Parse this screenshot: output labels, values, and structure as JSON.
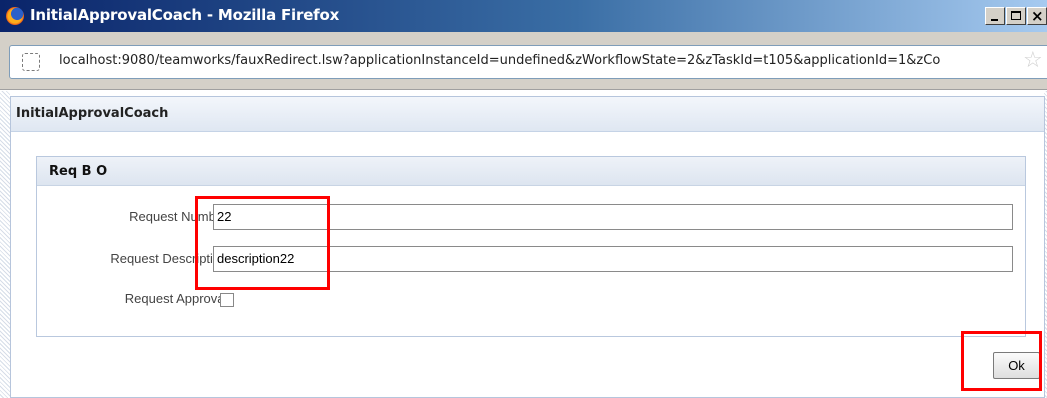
{
  "window": {
    "title": "InitialApprovalCoach - Mozilla Firefox",
    "app_icon": "firefox-icon",
    "controls": {
      "minimize": "minimize-icon",
      "maximize": "maximize-icon",
      "close": "×"
    }
  },
  "address_bar": {
    "url": "localhost:9080/teamworks/fauxRedirect.lsw?applicationInstanceId=undefined&zWorkflowState=2&zTaskId=t105&applicationId=1&zCo",
    "site_icon": "page-icon",
    "bookmark_icon": "☆"
  },
  "coach": {
    "title": "InitialApprovalCoach",
    "section": {
      "title": "Req B O",
      "fields": [
        {
          "label": "Request Number:",
          "value": "22"
        },
        {
          "label": "Request Description:",
          "value": "description22"
        },
        {
          "label": "Request Approval:",
          "checked": false
        }
      ]
    },
    "ok_button": "Ok"
  },
  "annotations": {
    "highlight_color": "#ff0000"
  }
}
